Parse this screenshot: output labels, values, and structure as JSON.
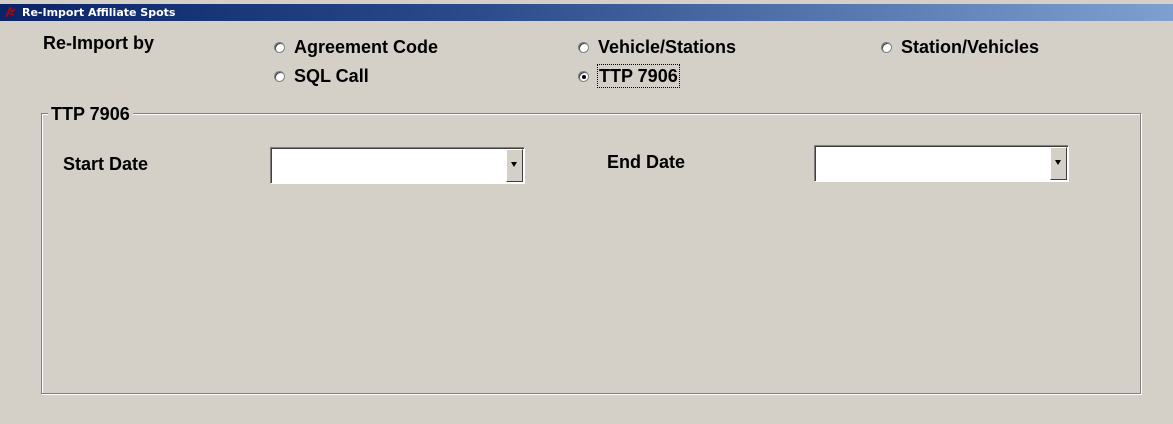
{
  "window": {
    "title": "Re-Import Affiliate Spots",
    "icon": "app-icon"
  },
  "reimport": {
    "label": "Re-Import by",
    "options": [
      {
        "label": "Agreement Code",
        "selected": false
      },
      {
        "label": "Vehicle/Stations",
        "selected": false
      },
      {
        "label": "Station/Vehicles",
        "selected": false
      },
      {
        "label": "SQL Call",
        "selected": false
      },
      {
        "label": "TTP 7906",
        "selected": true
      }
    ]
  },
  "group": {
    "title": "TTP 7906",
    "start_date": {
      "label": "Start Date",
      "value": ""
    },
    "end_date": {
      "label": "End Date",
      "value": ""
    }
  }
}
